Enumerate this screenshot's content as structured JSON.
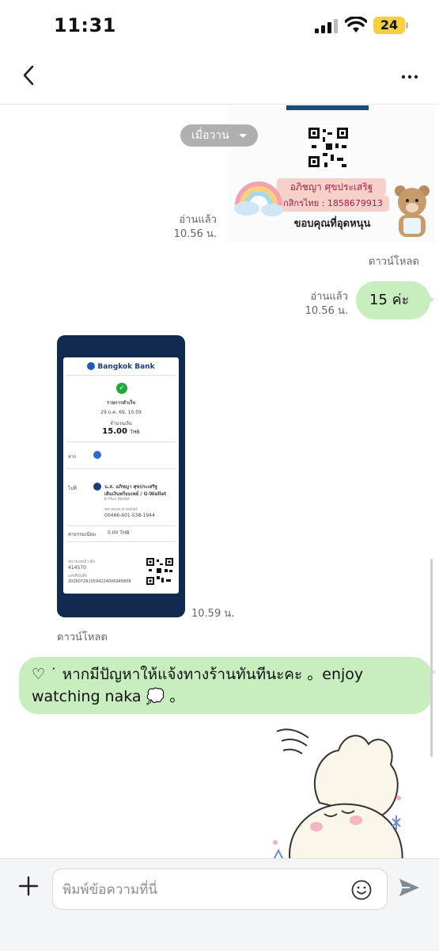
{
  "status_bar": {
    "time": "11:31",
    "battery": "24"
  },
  "date_pill": {
    "label": "เมื่อวาน"
  },
  "messages": {
    "qr_image": {
      "name": "อภิชญา ศุขประเสริฐ",
      "account": "กสิกรไทย : 1858679913",
      "thanks": "ขอบคุณที่อุดหนุน",
      "read_status": "อ่านแล้ว",
      "time": "10.56 น.",
      "download_label": "ดาวน์โหลด"
    },
    "sent_text": {
      "text": "15 ค่ะ",
      "read_status": "อ่านแล้ว",
      "time": "10.56 น."
    },
    "receipt_image": {
      "bank_name": "Bangkok Bank",
      "status": "รายการสำเร็จ",
      "datetime": "29 ก.ค. 69, 10:59",
      "amount_label": "จำนวนเงิน",
      "amount": "15.00",
      "currency": "THB",
      "from_label": "จาก",
      "to_label": "ไปที่",
      "recipient": "น.ส. อภิชญา ศุขประเสริฐ",
      "recipient_sub": "เติมเงินพร้อมเพย์ / G-Wallet",
      "recipient_bank": "K Plus Wallet",
      "wallet_label": "หมายเลข e-wallet",
      "wallet_no": "00466-601-538-1944",
      "fee_label": "ค่าธรรมเนียม",
      "fee": "0.00 THB",
      "ref_label": "หมายเลขอ้างอิง",
      "ref_no": "414570",
      "ref2_label": "เลขที่บันทึก",
      "ref2_no": "2026072910594224006945808",
      "time": "10.59 น.",
      "download_label": "ดาวน์โหลด"
    },
    "received_text": {
      "text": "♡ ˙ หากมีปัญหาให้แจ้งทางร้านทันทีนะคะ  。enjoy watching naka 💭 。"
    }
  },
  "input_bar": {
    "placeholder": "พิมพ์ข้อความที่นี่"
  },
  "colors": {
    "bubble": "#c8eec0",
    "receipt_bg": "#112a4e",
    "accent": "#2e6bd1"
  },
  "icons": [
    "back-arrow-icon",
    "more-icon",
    "plus-icon",
    "emoji-icon",
    "send-icon"
  ]
}
